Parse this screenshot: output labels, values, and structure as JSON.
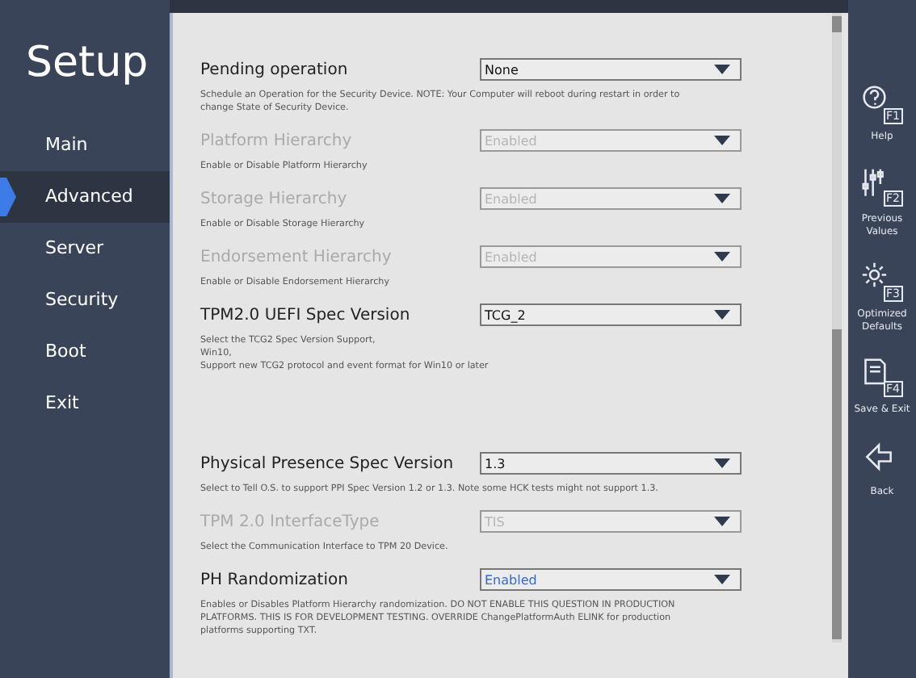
{
  "sidebar": {
    "title": "Setup",
    "items": [
      {
        "label": "Main",
        "selected": false
      },
      {
        "label": "Advanced",
        "selected": true
      },
      {
        "label": "Server",
        "selected": false
      },
      {
        "label": "Security",
        "selected": false
      },
      {
        "label": "Boot",
        "selected": false
      },
      {
        "label": "Exit",
        "selected": false
      }
    ]
  },
  "settings": [
    {
      "label": "Pending operation",
      "value": "None",
      "disabled": false,
      "focused": false,
      "description": [
        "Schedule an Operation for the Security Device. NOTE: Your Computer will reboot during restart in order to change State of Security Device."
      ]
    },
    {
      "label": "Platform Hierarchy",
      "value": "Enabled",
      "disabled": true,
      "focused": false,
      "description": [
        "Enable or Disable Platform Hierarchy"
      ]
    },
    {
      "label": "Storage Hierarchy",
      "value": "Enabled",
      "disabled": true,
      "focused": false,
      "description": [
        "Enable or Disable Storage Hierarchy"
      ]
    },
    {
      "label": "Endorsement Hierarchy",
      "value": "Enabled",
      "disabled": true,
      "focused": false,
      "description": [
        "Enable or Disable Endorsement Hierarchy"
      ]
    },
    {
      "label": "TPM2.0 UEFI Spec Version",
      "value": "TCG_2",
      "disabled": false,
      "focused": false,
      "description": [
        "Select the TCG2 Spec Version Support,",
        "Win10,",
        "Support new TCG2 protocol and event format for Win10 or later"
      ]
    },
    {
      "label": "Physical Presence Spec Version",
      "value": "1.3",
      "disabled": false,
      "focused": false,
      "description": [
        "Select to Tell O.S. to support PPI Spec Version 1.2 or 1.3. Note some HCK tests might not support 1.3."
      ]
    },
    {
      "label": "TPM 2.0 InterfaceType",
      "value": "TIS",
      "disabled": true,
      "focused": false,
      "description": [
        "Select the Communication Interface to TPM 20 Device."
      ]
    },
    {
      "label": "PH Randomization",
      "value": "Enabled",
      "disabled": false,
      "focused": true,
      "description": [
        "Enables or Disables Platform Hierarchy randomization. DO NOT ENABLE THIS QUESTION IN PRODUCTION PLATFORMS. THIS IS FOR DEVELOPMENT TESTING. OVERRIDE ChangePlatformAuth ELINK for production platforms supporting TXT."
      ]
    }
  ],
  "actions": [
    {
      "kind": "help",
      "key": "F1",
      "label": "Help"
    },
    {
      "kind": "previous",
      "key": "F2",
      "label": "Previous Values"
    },
    {
      "kind": "defaults",
      "key": "F3",
      "label": "Optimized Defaults"
    },
    {
      "kind": "save",
      "key": "F4",
      "label": "Save & Exit"
    },
    {
      "kind": "back",
      "label": "Back"
    }
  ]
}
